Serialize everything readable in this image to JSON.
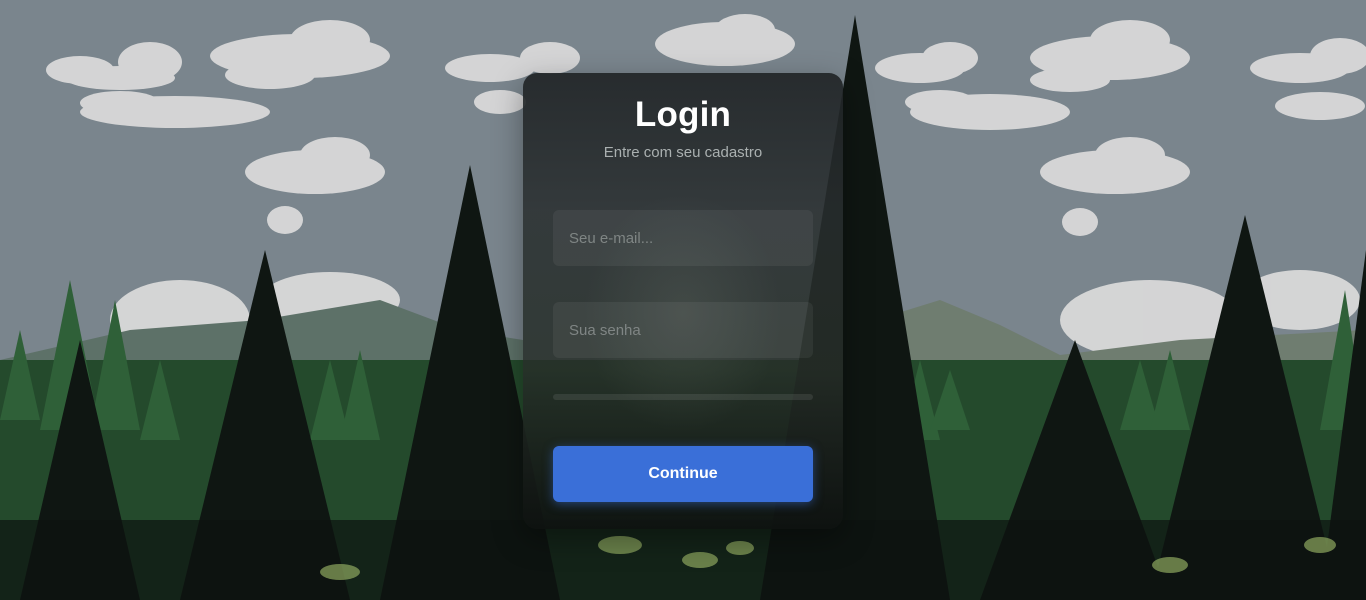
{
  "login": {
    "title": "Login",
    "subtitle": "Entre com seu cadastro",
    "email_placeholder": "Seu e-mail...",
    "email_value": "",
    "password_placeholder": "Sua senha",
    "password_value": "",
    "continue_label": "Continue"
  },
  "colors": {
    "accent": "#3a6fd8",
    "sky": "#7a858d",
    "forest": "#2f5a36",
    "card": "#2a2e30"
  },
  "background": {
    "icon": "forest-landscape-image"
  }
}
